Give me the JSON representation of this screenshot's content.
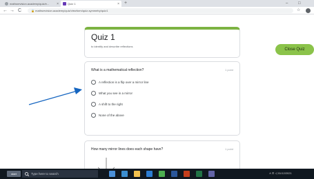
{
  "browser": {
    "tabs": [
      {
        "label": "mathsrevision.academy/quiz/e..."
      },
      {
        "label": "Quiz 1"
      }
    ],
    "new_tab": "+",
    "window_controls": [
      "–",
      "□"
    ],
    "url": "mathsrevision.academy/quiz/viewform/quiz-symmetry/quiz1",
    "nav": {
      "back": "←",
      "forward": "→",
      "reload": "C"
    },
    "star": "☆"
  },
  "quiz": {
    "title": "Quiz 1",
    "subtitle": "to identify and describe reflections",
    "question1": {
      "text": "What is a mathematical reflection?",
      "points": "1 point",
      "options": [
        "A reflection is a flip over a mirror line",
        "What you see in a mirror",
        "A shift to the right",
        "None of the above"
      ]
    },
    "question2": {
      "text": "How many mirror lines does each shape have?",
      "points": "1 point"
    }
  },
  "close_button": "Close Quiz",
  "taskbar": {
    "start_label": "start",
    "search_placeholder": "Type here to search",
    "tray_text": "∧ ⊡ ◁ 01/12/2021"
  },
  "colors": {
    "accent_green": "#7cb342",
    "close_button_green": "#8bc34a",
    "arrow_blue": "#1565c0"
  }
}
